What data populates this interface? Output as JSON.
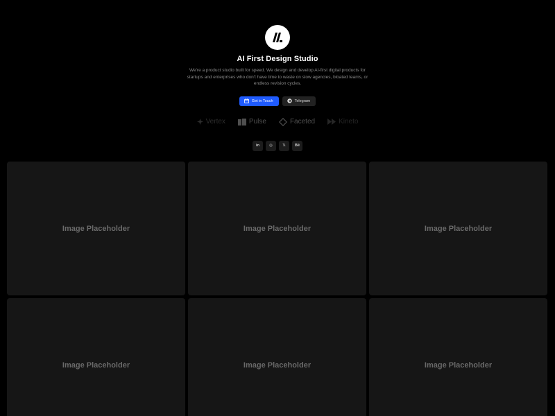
{
  "hero": {
    "logo_icon": "studio-logo-icon",
    "title": "AI First Design Studio",
    "description": "We're a product studio built for speed. We design and develop AI-first digital products for startups and enterprises who don't have time to waste on slow agencies, bloated teams, or endless revision cycles."
  },
  "cta": {
    "primary_label": "Get in Touch",
    "primary_icon": "calendar-icon",
    "secondary_label": "Telegram",
    "secondary_icon": "telegram-icon",
    "accent_color": "#1f5bff"
  },
  "brands": [
    {
      "label": "Vertex",
      "icon": "vertex-icon"
    },
    {
      "label": "Pulse",
      "icon": "pulse-icon"
    },
    {
      "label": "Faceted",
      "icon": "faceted-icon"
    },
    {
      "label": "Kineto",
      "icon": "kineto-icon"
    }
  ],
  "social": [
    {
      "label": "in",
      "icon": "linkedin-icon"
    },
    {
      "label": "◎",
      "icon": "dribbble-icon"
    },
    {
      "label": "𝕏",
      "icon": "x-icon"
    },
    {
      "label": "Bē",
      "icon": "behance-icon"
    }
  ],
  "gallery": [
    {
      "label": "Image Placeholder"
    },
    {
      "label": "Image Placeholder"
    },
    {
      "label": "Image Placeholder"
    },
    {
      "label": "Image Placeholder"
    },
    {
      "label": "Image Placeholder"
    },
    {
      "label": "Image Placeholder"
    }
  ]
}
